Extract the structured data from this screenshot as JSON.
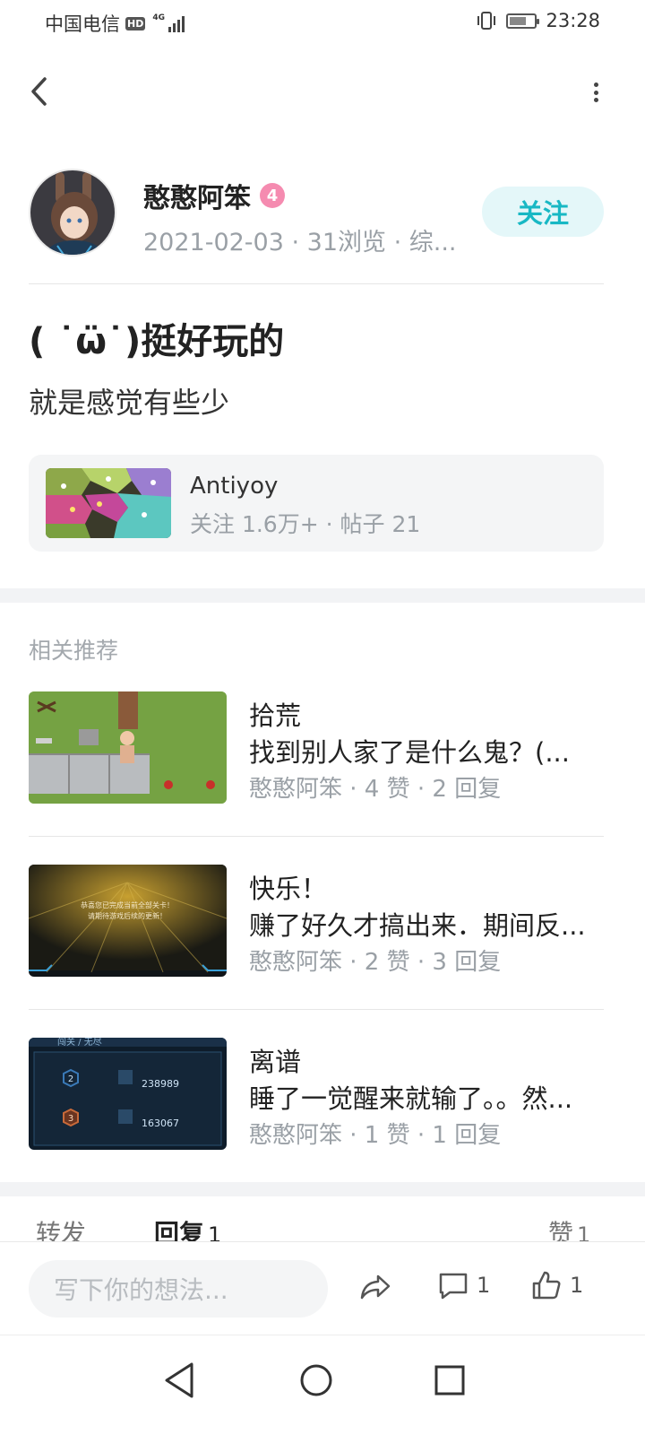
{
  "status_bar": {
    "carrier": "中国电信",
    "hd": "HD",
    "network": "4G",
    "time": "23:28"
  },
  "author": {
    "name": "憨憨阿笨",
    "level": "4",
    "meta": "2021-02-03 · 31浏览 · 综..."
  },
  "follow_label": "关注",
  "post": {
    "title": "( ˙ω̈˙)挺好玩的",
    "body": "就是感觉有些少"
  },
  "game": {
    "name": "Antiyoy",
    "stats": "关注 1.6万+ · 帖子 21"
  },
  "recommend": {
    "header": "相关推荐",
    "items": [
      {
        "title": "拾荒",
        "desc": "找到别人家了是什么鬼？(...",
        "meta": "憨憨阿笨 · 4 赞 · 2 回复"
      },
      {
        "title": "快乐！",
        "desc": "赚了好久才搞出来．期间反...",
        "meta": "憨憨阿笨 · 2 赞 · 3 回复",
        "thumb_text_1": "恭喜您已完成当前全部关卡！",
        "thumb_text_2": "请期待游戏后续的更新！"
      },
      {
        "title": "离谱",
        "desc": "睡了一觉醒来就输了。。然...",
        "meta": "憨憨阿笨 · 1 赞 · 1 回复",
        "thumb_header": "闯关 / 无尽",
        "thumb_rows": [
          {
            "rank": "2",
            "score": "238989"
          },
          {
            "rank": "3",
            "score": "163067"
          }
        ]
      }
    ]
  },
  "tabs": {
    "repost": "转发",
    "reply": "回复",
    "reply_count": "1",
    "like": "赞",
    "like_count": "1"
  },
  "bottom": {
    "input_placeholder": "写下你的想法...",
    "comment_count": "1",
    "like_count": "1"
  },
  "colors": {
    "accent": "#18b8c4",
    "level_badge": "#f58bb0"
  }
}
